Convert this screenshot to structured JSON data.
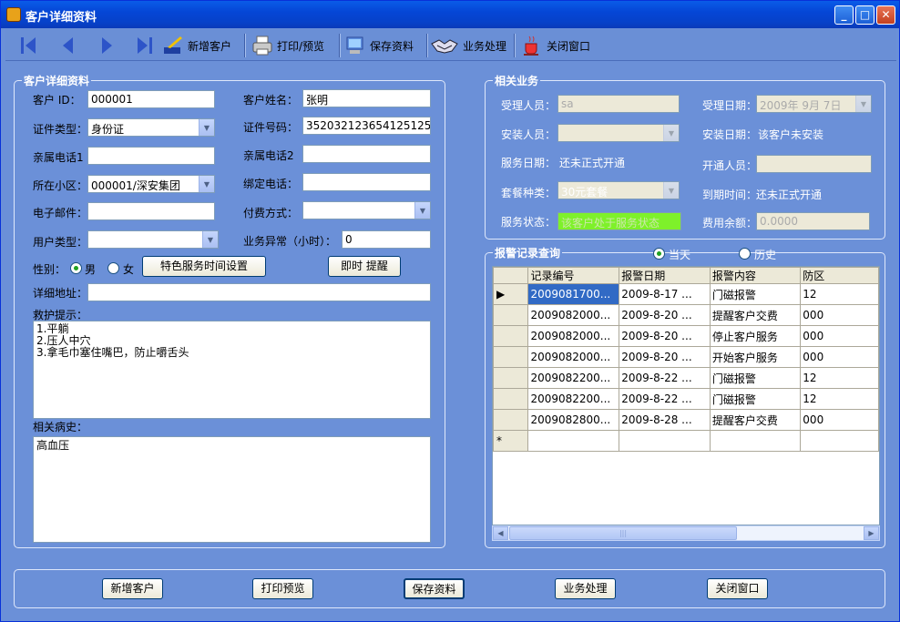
{
  "window": {
    "title": "客户详细资料",
    "min": "_",
    "max": "□",
    "close": "✕"
  },
  "toolbar": {
    "add": "新增客户",
    "print": "打印/预览",
    "save": "保存资料",
    "business": "业务处理",
    "close": "关闭窗口"
  },
  "detail": {
    "legend": "客户详细资料",
    "id_label": "客户 ID：",
    "id": "000001",
    "name_label": "客户姓名：",
    "name": "张明",
    "idtype_label": "证件类型：",
    "idtype": "身份证",
    "idno_label": "证件号码：",
    "idno": "352032123654125125",
    "phone1_label": "亲属电话1",
    "phone1": "",
    "phone2_label": "亲属电话2",
    "phone2": "",
    "community_label": "所在小区：",
    "community": "000001/深安集团",
    "bound_label": "绑定电话：",
    "bound": "",
    "email_label": "电子邮件：",
    "email": "",
    "pay_label": "付费方式：",
    "pay": "",
    "usertype_label": "用户类型：",
    "usertype": "",
    "abn_label": "业务异常（小时）：",
    "abn": "0",
    "gender_label": "性别：",
    "male": "男",
    "female": "女",
    "special_btn": "特色服务时间设置",
    "instant_btn": "即时 提醒",
    "addr_label": "详细地址：",
    "addr": "",
    "rescue_label": "救护提示：",
    "rescue": "1.平躺\n2.压人中穴\n3.拿毛巾塞住嘴巴，防止嚼舌头",
    "history_label": "相关病史：",
    "history": "高血压"
  },
  "business": {
    "legend": "相关业务",
    "handler_label": "受理人员：",
    "handler": "sa",
    "date_label": "受理日期：",
    "date": "2009年 9月 7日",
    "installer_label": "安装人员：",
    "installer": "",
    "installdate_label": "安装日期：",
    "installdate": "该客户未安装",
    "servicedate_label": "服务日期：",
    "servicedate": "还未正式开通",
    "opener_label": "开通人员：",
    "opener": "",
    "package_label": "套餐种类：",
    "package": "30元套餐",
    "expire_label": "到期时间：",
    "expire": "还未正式开通",
    "status_label": "服务状态：",
    "status": "该客户处于服务状态",
    "balance_label": "费用余额：",
    "balance": "0.0000"
  },
  "alarm": {
    "legend": "报警记录查询",
    "today": "当天",
    "history": "历史",
    "columns": [
      "记录编号",
      "报警日期",
      "报警内容",
      "防区"
    ],
    "rows": [
      [
        "2009081700...",
        "2009-8-17 ...",
        "门磁报警",
        "12"
      ],
      [
        "2009082000...",
        "2009-8-20 ...",
        "提醒客户交费",
        "000"
      ],
      [
        "2009082000...",
        "2009-8-20 ...",
        "停止客户服务",
        "000"
      ],
      [
        "2009082000...",
        "2009-8-20 ...",
        "开始客户服务",
        "000"
      ],
      [
        "2009082200...",
        "2009-8-22 ...",
        "门磁报警",
        "12"
      ],
      [
        "2009082200...",
        "2009-8-22 ...",
        "门磁报警",
        "12"
      ],
      [
        "2009082800...",
        "2009-8-28 ...",
        "提醒客户交费",
        "000"
      ]
    ],
    "current_marker": "▶",
    "new_marker": "*"
  },
  "bottom": {
    "add": "新增客户",
    "print": "打印预览",
    "save": "保存资料",
    "business": "业务处理",
    "close": "关闭窗口"
  }
}
